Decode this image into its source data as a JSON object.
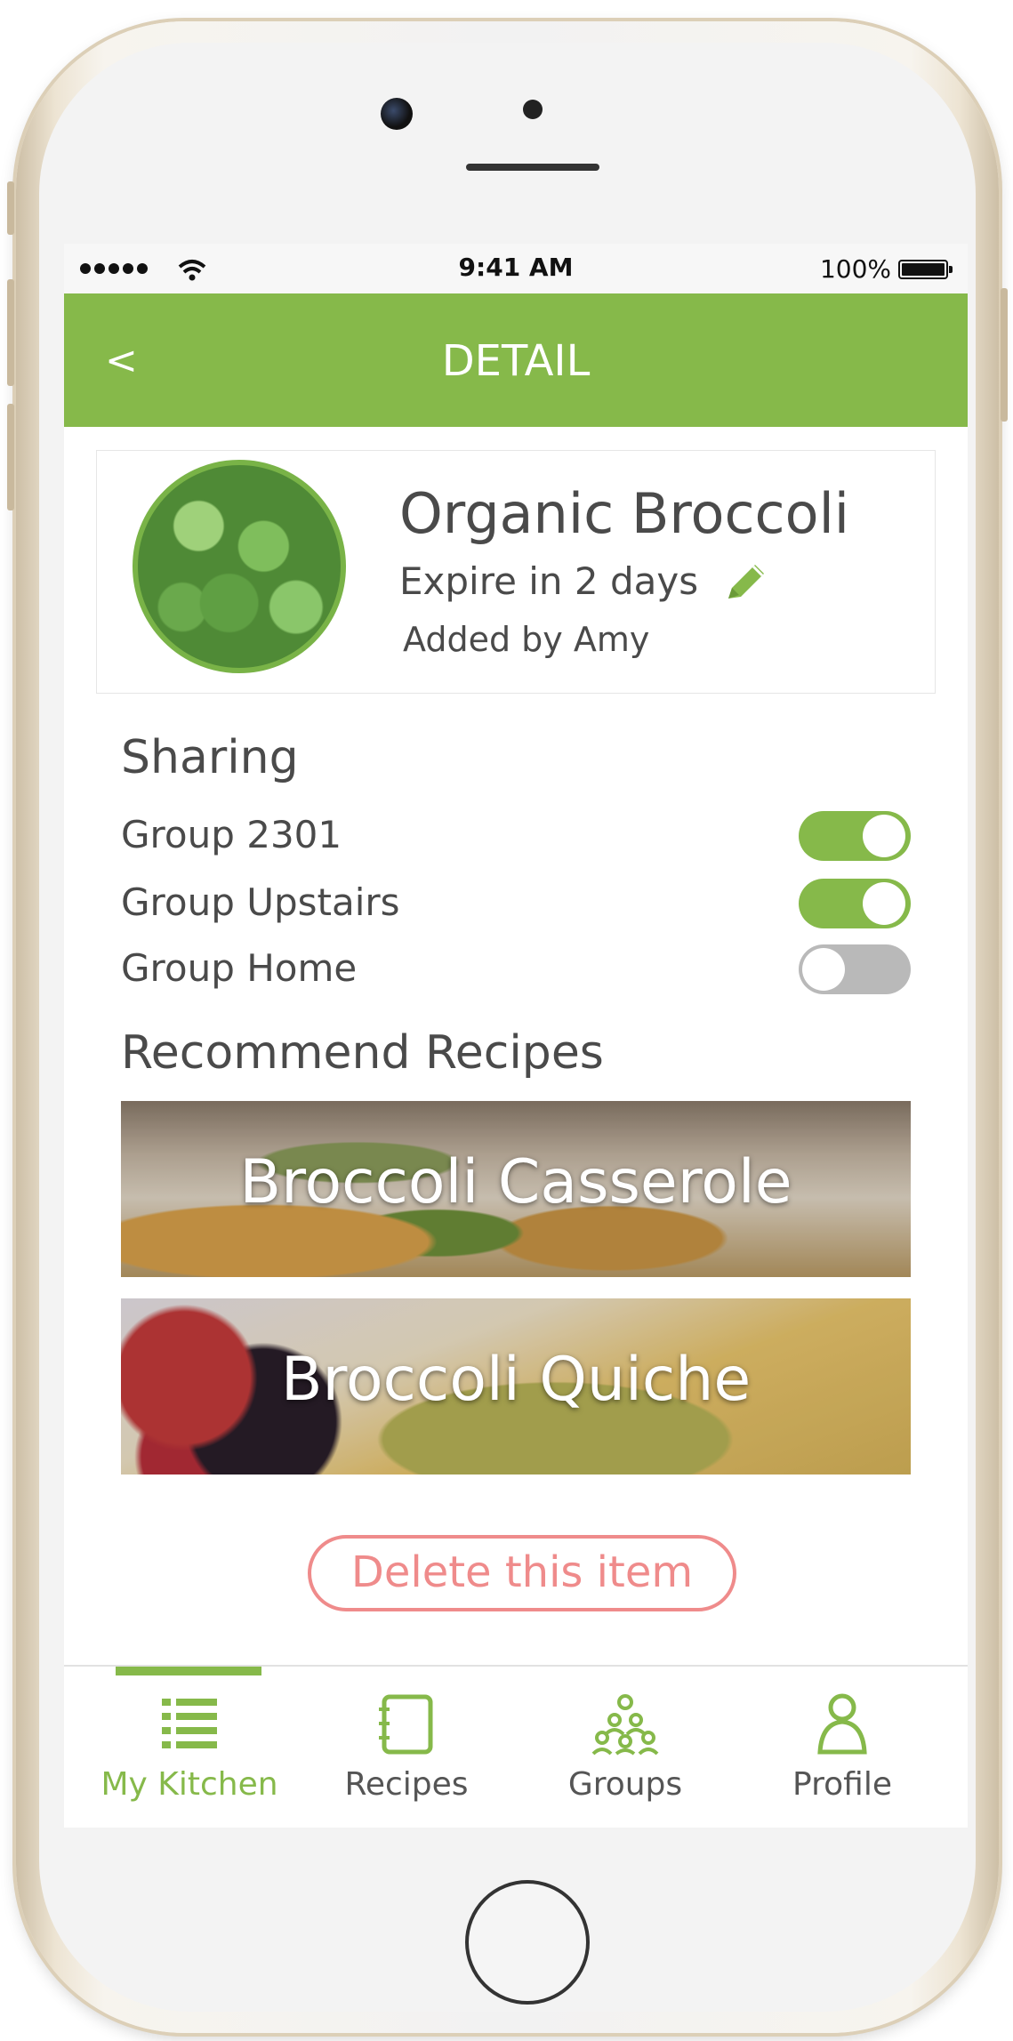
{
  "status_bar": {
    "time": "9:41 AM",
    "battery": "100%"
  },
  "nav": {
    "back_label": "<",
    "title": "DETAIL"
  },
  "item": {
    "name": "Organic Broccoli",
    "expiry": "Expire in 2 days",
    "added_by": "Added by Amy"
  },
  "sharing": {
    "title": "Sharing",
    "groups": [
      {
        "label": "Group 2301",
        "enabled": true
      },
      {
        "label": "Group Upstairs",
        "enabled": true
      },
      {
        "label": "Group Home",
        "enabled": false
      }
    ]
  },
  "recipes": {
    "title": "Recommend Recipes",
    "items": [
      {
        "title": "Broccoli Casserole"
      },
      {
        "title": "Broccoli Quiche"
      }
    ]
  },
  "delete_label": "Delete this item",
  "tabs": [
    {
      "label": "My Kitchen",
      "icon": "list-icon",
      "active": true
    },
    {
      "label": "Recipes",
      "icon": "notebook-icon",
      "active": false
    },
    {
      "label": "Groups",
      "icon": "group-icon",
      "active": false
    },
    {
      "label": "Profile",
      "icon": "person-icon",
      "active": false
    }
  ],
  "colors": {
    "accent": "#86b94a",
    "danger": "#ef8b8b",
    "text": "#4a4a4a"
  }
}
